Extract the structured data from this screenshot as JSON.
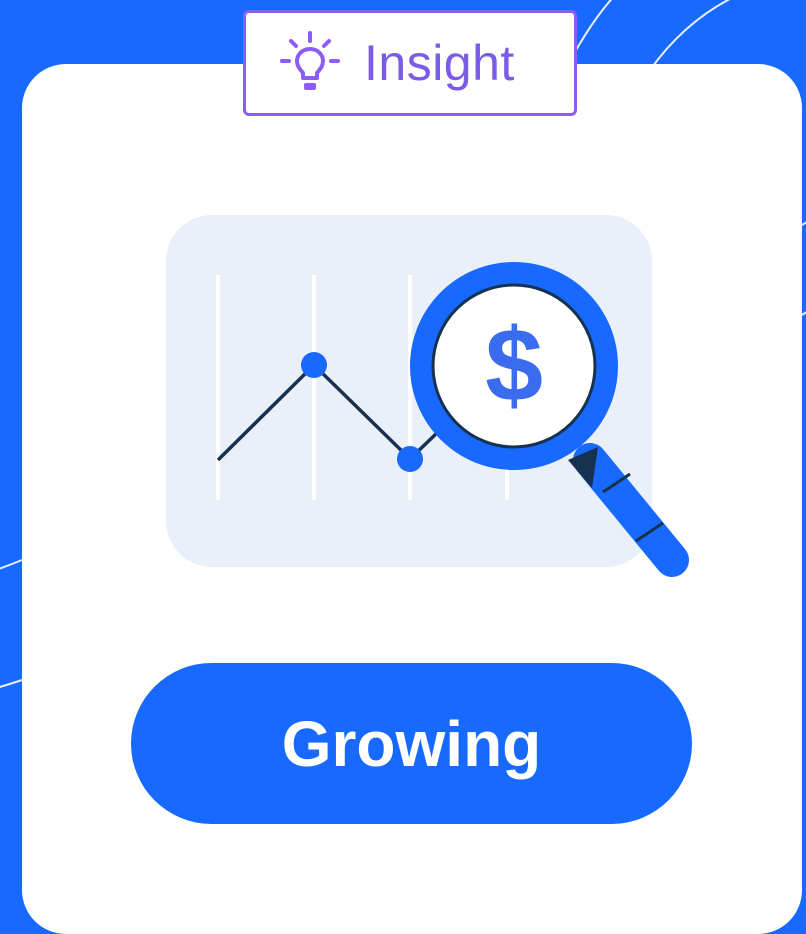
{
  "badge": {
    "label": "Insight",
    "icon": "lightbulb-icon",
    "color": "#7c5ce6"
  },
  "illustration": {
    "icon": "magnifier-dollar-icon",
    "symbol": "$",
    "subject": "line-chart-with-magnifying-glass"
  },
  "status": {
    "label": "Growing"
  },
  "colors": {
    "background": "#1769ff",
    "card": "#ffffff",
    "accent": "#1769ff",
    "chart_panel": "#e9f0fa",
    "line": "#16324f",
    "dollar": "#3b6cf0"
  }
}
